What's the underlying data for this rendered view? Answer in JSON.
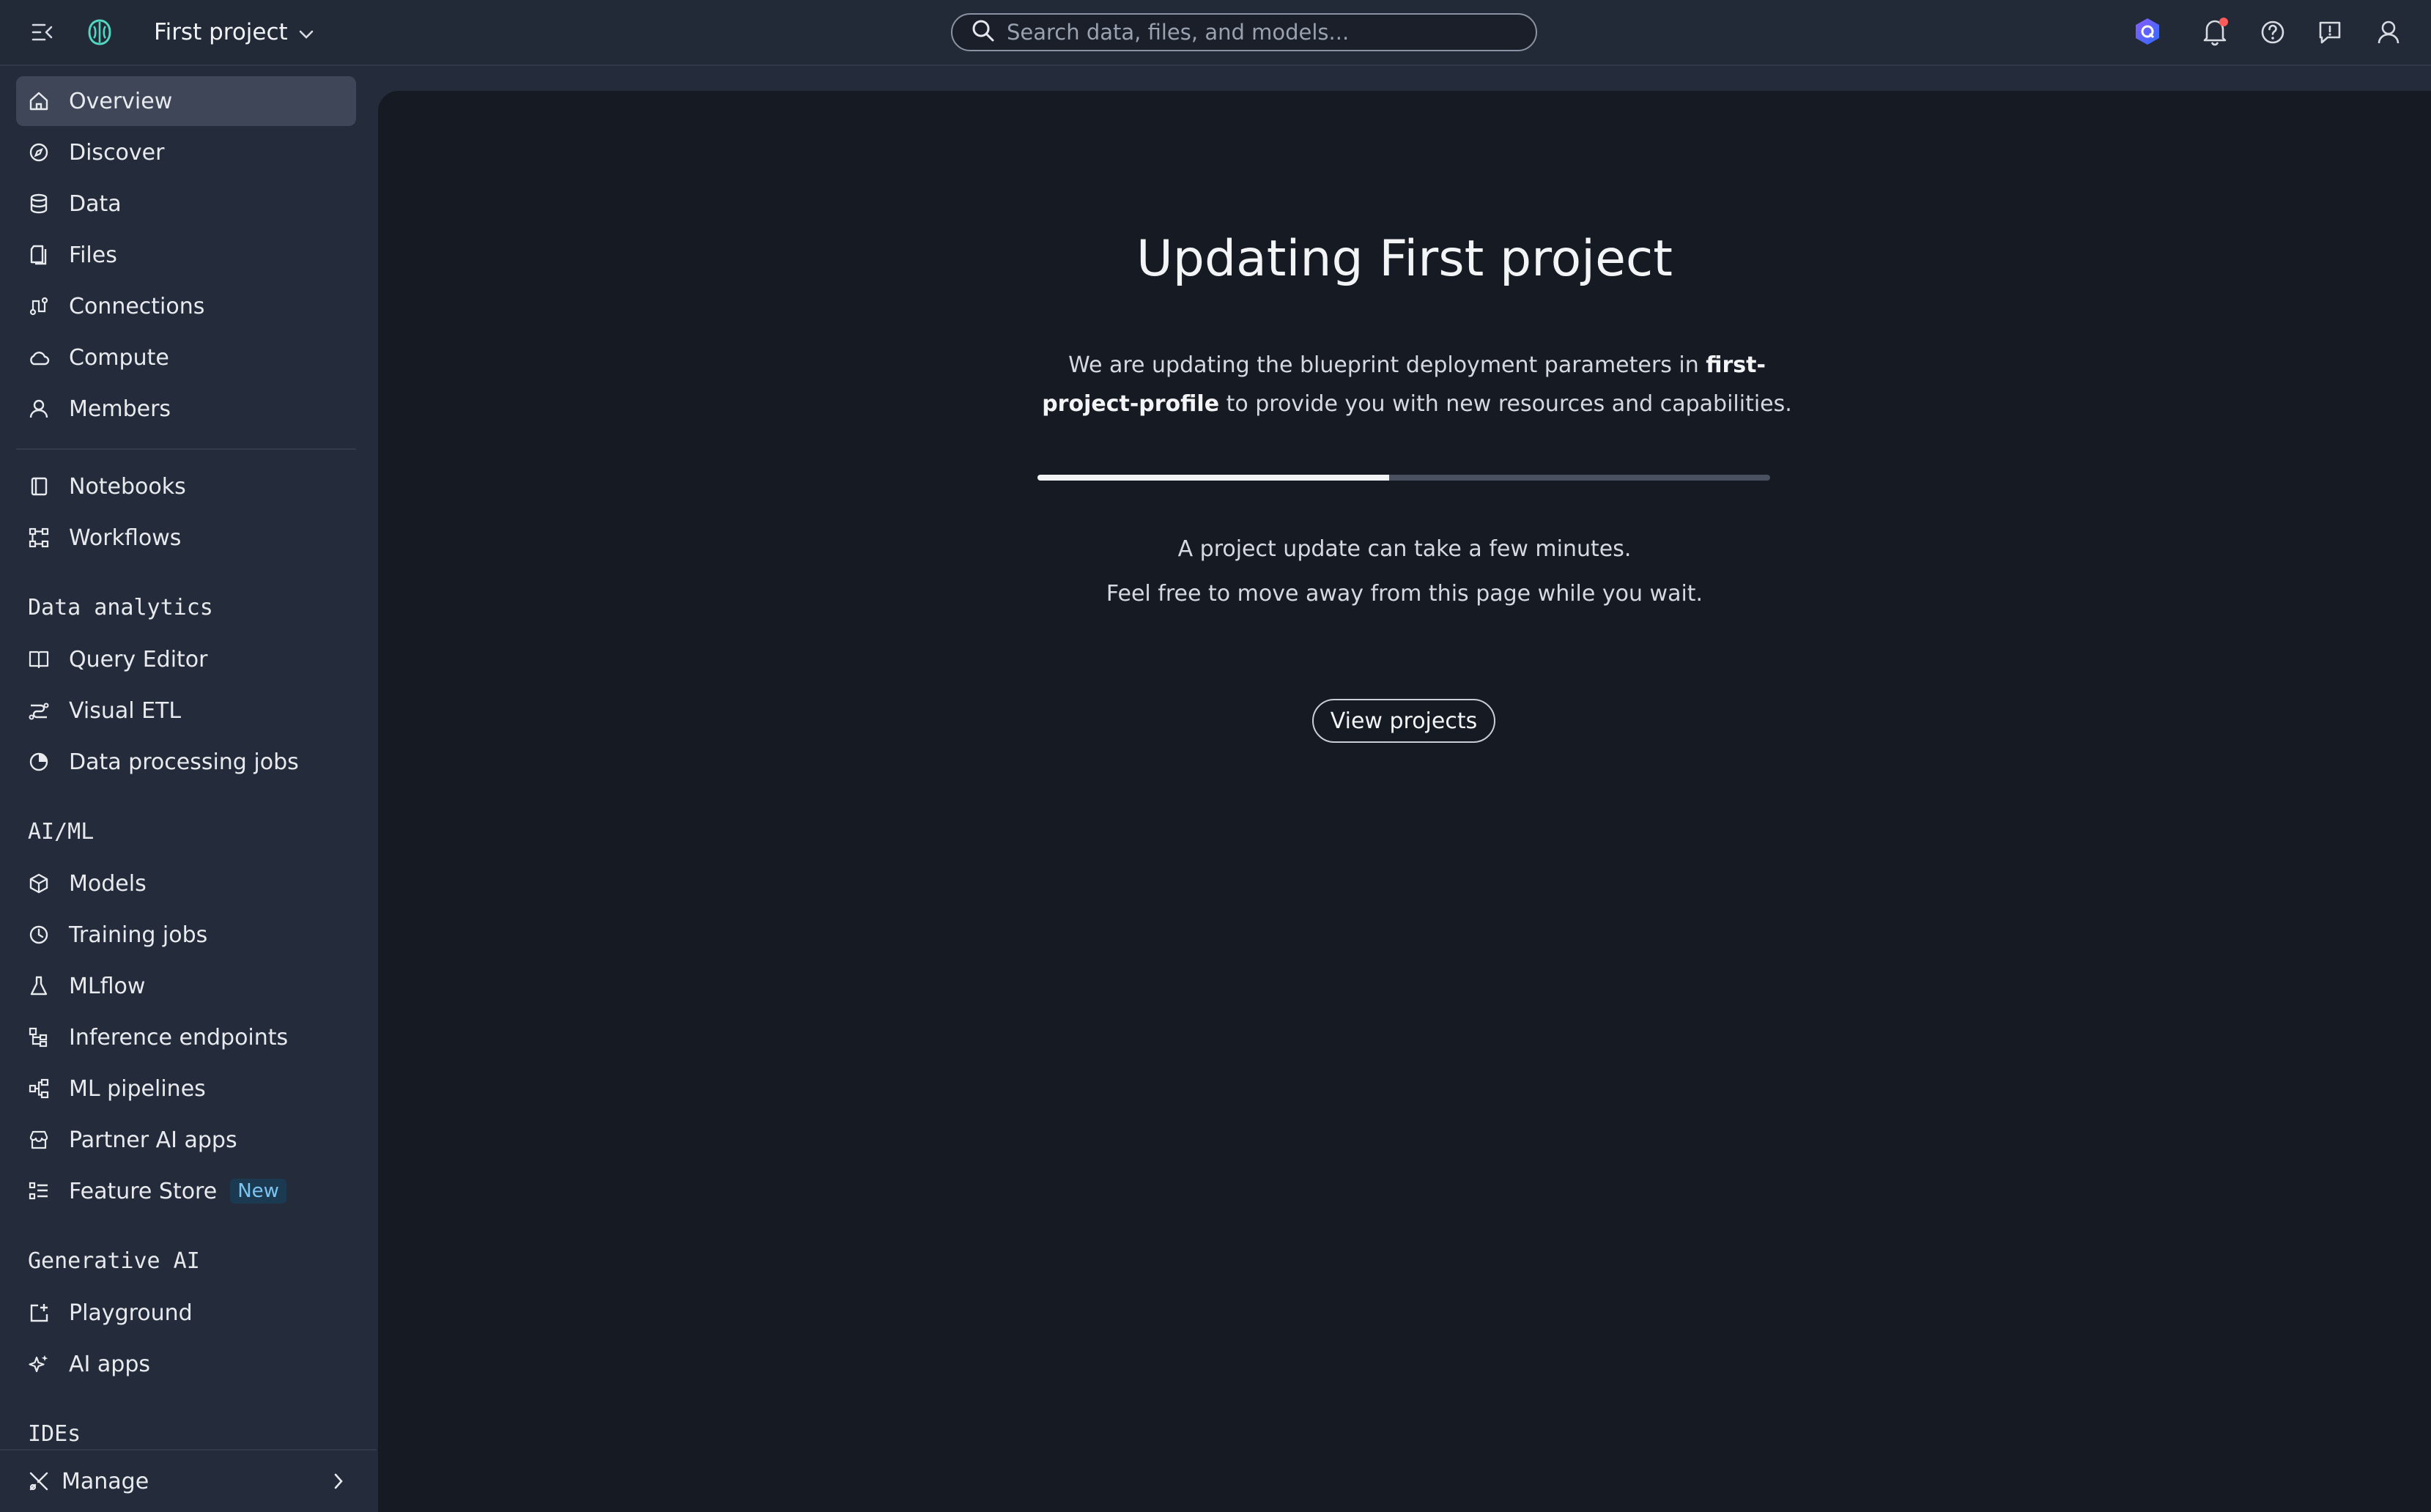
{
  "topbar": {
    "project_name": "First project",
    "search_placeholder": "Search data, files, and models...",
    "icons": [
      "menu-collapse-icon",
      "app-logo-icon",
      "chevron-down-icon",
      "search-icon",
      "amazon-q-icon",
      "notifications-icon",
      "help-icon",
      "feedback-icon",
      "user-icon"
    ],
    "notification_dot_color": "#ff5b5b"
  },
  "sidebar": {
    "primary": [
      {
        "label": "Overview",
        "icon": "home-icon",
        "active": true
      },
      {
        "label": "Discover",
        "icon": "compass-icon"
      },
      {
        "label": "Data",
        "icon": "database-icon"
      },
      {
        "label": "Files",
        "icon": "file-icon"
      },
      {
        "label": "Connections",
        "icon": "connections-icon"
      },
      {
        "label": "Compute",
        "icon": "cloud-icon"
      },
      {
        "label": "Members",
        "icon": "user-icon"
      }
    ],
    "tools": [
      {
        "label": "Notebooks",
        "icon": "notebook-icon"
      },
      {
        "label": "Workflows",
        "icon": "workflow-icon"
      }
    ],
    "data_analytics": {
      "title": "Data analytics",
      "items": [
        {
          "label": "Query Editor",
          "icon": "book-icon"
        },
        {
          "label": "Visual ETL",
          "icon": "etl-icon"
        },
        {
          "label": "Data processing jobs",
          "icon": "processing-icon"
        }
      ]
    },
    "aiml": {
      "title": "AI/ML",
      "items": [
        {
          "label": "Models",
          "icon": "cube-icon"
        },
        {
          "label": "Training jobs",
          "icon": "clock-icon"
        },
        {
          "label": "MLflow",
          "icon": "flask-icon"
        },
        {
          "label": "Inference endpoints",
          "icon": "endpoint-icon"
        },
        {
          "label": "ML pipelines",
          "icon": "pipeline-icon"
        },
        {
          "label": "Partner AI apps",
          "icon": "store-icon"
        },
        {
          "label": "Feature Store",
          "icon": "list-icon",
          "badge": "New"
        }
      ]
    },
    "genai": {
      "title": "Generative AI",
      "items": [
        {
          "label": "Playground",
          "icon": "playground-icon"
        },
        {
          "label": "AI apps",
          "icon": "sparkle-icon"
        }
      ]
    },
    "ides_title": "IDEs",
    "manage_label": "Manage"
  },
  "main": {
    "title": "Updating First project",
    "desc_pre": "We are updating the blueprint deployment parameters in ",
    "desc_bold": "first-project-profile",
    "desc_post": " to provide you with new resources and capabilities.",
    "progress": 0.48,
    "note_line1": "A project update can take a few minutes.",
    "note_line2": "Feel free to move away from this page while you wait.",
    "button_label": "View projects"
  }
}
